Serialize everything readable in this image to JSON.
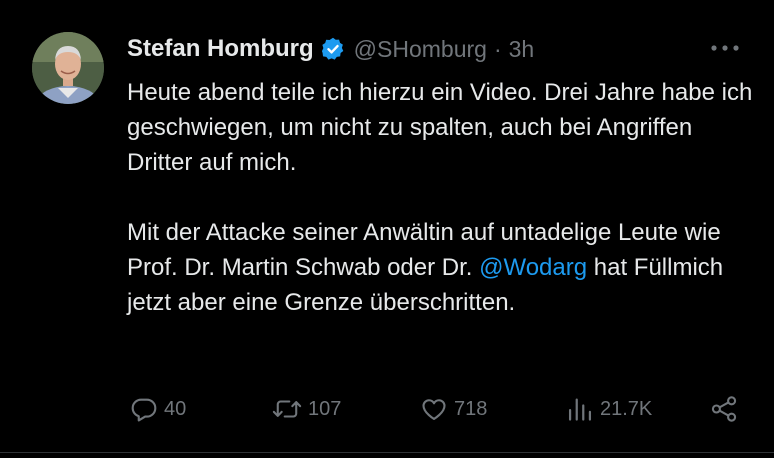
{
  "author": {
    "name": "Stefan Homburg",
    "handle": "@SHomburg",
    "separator": "·",
    "time": "3h"
  },
  "colors": {
    "background": "#000000",
    "text": "#e7e9ea",
    "muted": "#71767b",
    "accent": "#1d9bf0"
  },
  "icons": {
    "verified": "verified-badge-icon",
    "more": "more-options-icon",
    "reply": "reply-icon",
    "retweet": "retweet-icon",
    "like": "like-icon",
    "views": "views-icon",
    "share": "share-icon"
  },
  "tweet": {
    "paragraph1": "Heute abend teile ich hierzu ein Video. Drei Jahre habe ich geschwiegen, um nicht zu spalten, auch bei Angriffen Dritter auf mich.",
    "paragraph2_before": "Mit der Attacke seiner Anwältin auf untadelige Leute wie Prof. Dr. Martin Schwab oder Dr. ",
    "mention": "@Wodarg",
    "paragraph2_after": " hat Füllmich jetzt aber eine Grenze überschritten."
  },
  "stats": {
    "replies": "40",
    "retweets": "107",
    "likes": "718",
    "views": "21.7K"
  }
}
